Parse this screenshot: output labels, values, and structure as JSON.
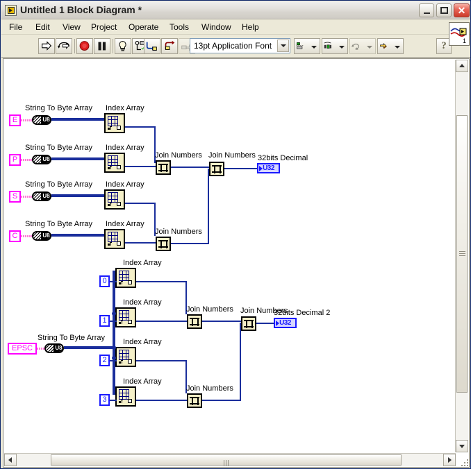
{
  "window": {
    "title": "Untitled 1 Block Diagram *",
    "icon": "labview-vi-icon",
    "buttons": {
      "minimize": "minimize-button",
      "maximize": "maximize-button",
      "close_glyph": "✕"
    }
  },
  "menu": {
    "items": [
      {
        "label": "File",
        "accel": "F"
      },
      {
        "label": "Edit",
        "accel": "E"
      },
      {
        "label": "View",
        "accel": "V"
      },
      {
        "label": "Project",
        "accel": "P"
      },
      {
        "label": "Operate",
        "accel": "O"
      },
      {
        "label": "Tools",
        "accel": "T"
      },
      {
        "label": "Window",
        "accel": "W"
      },
      {
        "label": "Help",
        "accel": "H"
      }
    ]
  },
  "toolbar": {
    "buttons": [
      {
        "name": "run-button",
        "icon": "right-arrow-icon"
      },
      {
        "name": "run-continuously-button",
        "icon": "run-continuous-icon"
      },
      {
        "name": "abort-execution-button",
        "icon": "stop-circle-icon"
      },
      {
        "name": "pause-button",
        "icon": "pause-icon"
      },
      {
        "name": "highlight-execution-button",
        "icon": "lightbulb-icon"
      },
      {
        "name": "retain-wire-values-button",
        "icon": "retain-wire-icon"
      },
      {
        "name": "step-into-button",
        "icon": "step-into-icon"
      },
      {
        "name": "step-over-button",
        "icon": "step-over-icon"
      },
      {
        "name": "step-out-button",
        "icon": "step-out-icon"
      }
    ],
    "font_combo": {
      "value": "13pt Application Font",
      "name": "font-selector"
    },
    "dropdowns": [
      {
        "name": "align-objects-dropdown",
        "icon": "align-objects-icon"
      },
      {
        "name": "distribute-objects-dropdown",
        "icon": "distribute-objects-icon"
      },
      {
        "name": "resize-objects-dropdown",
        "icon": "resize-objects-icon"
      },
      {
        "name": "reorder-dropdown",
        "icon": "reorder-icon"
      }
    ],
    "help_button": {
      "name": "context-help-button",
      "glyph": "?"
    },
    "vi_icon": {
      "name": "vi-icon-pane",
      "badge": "1"
    }
  },
  "diagram": {
    "labels": {
      "string_to_byte_array": "String To Byte Array",
      "index_array": "Index Array",
      "join_numbers": "Join Numbers",
      "decimal_1": "32bits Decimal",
      "decimal_2": "32bits Decimal 2"
    },
    "top_group": {
      "controls": [
        "E",
        "P",
        "S",
        "C"
      ],
      "index_constants": [],
      "indicator": {
        "label": "32bits Decimal",
        "type": "U32",
        "value": "U32"
      }
    },
    "bottom_group": {
      "control": "EPSC",
      "index_constants": [
        "0",
        "1",
        "2",
        "3"
      ],
      "indicator": {
        "label": "32bits Decimal 2",
        "type": "U32",
        "value": "U32"
      }
    }
  },
  "scrollbars": {
    "vertical": {
      "name": "vertical-scrollbar"
    },
    "horizontal": {
      "name": "horizontal-scrollbar"
    }
  },
  "colors": {
    "wire_blue": "#1a2e9c",
    "terminal_magenta": "#ff00ff",
    "constant_blue": "#1a1aff",
    "node_yellow": "#f5f0c8",
    "window_chrome": "#ece9d8"
  }
}
